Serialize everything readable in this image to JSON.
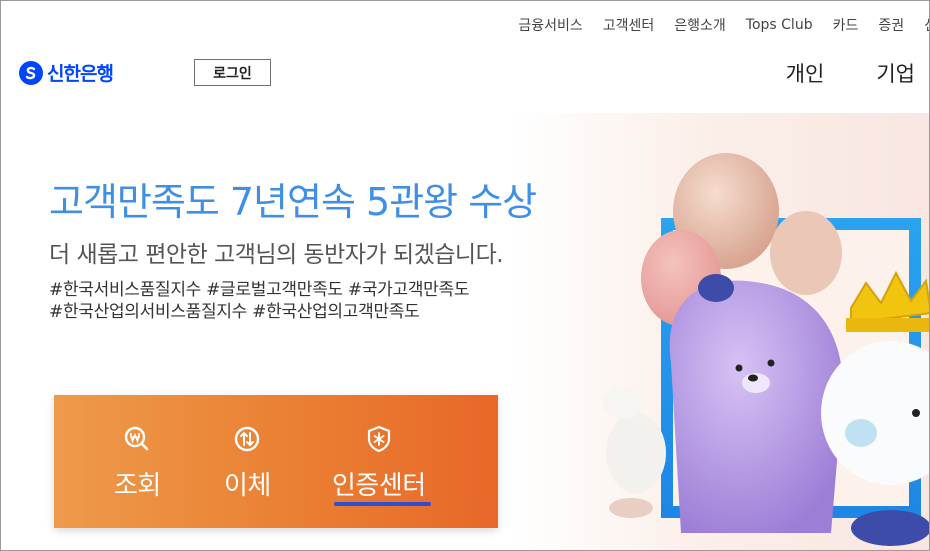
{
  "util_nav": [
    "금융서비스",
    "고객센터",
    "은행소개",
    "Tops Club",
    "카드",
    "증권",
    "신"
  ],
  "header": {
    "logo_text": "신한은행",
    "login_label": "로그인",
    "main_nav": [
      "개인",
      "기업"
    ]
  },
  "hero": {
    "title": "고객만족도 7년연속 5관왕 수상",
    "subtitle": "더 새롭고 편안한 고객님의 동반자가 되겠습니다.",
    "hashtags_line1": "#한국서비스품질지수  #글로벌고객만족도  #국가고객만족도",
    "hashtags_line2": "#한국산업의서비스품질지수  #한국산업의고객만족도"
  },
  "quick_menu": {
    "items": [
      {
        "label": "조회",
        "icon": "won-search-icon"
      },
      {
        "label": "이체",
        "icon": "transfer-arrows-icon"
      },
      {
        "label": "인증센터",
        "icon": "certificate-shield-icon"
      }
    ],
    "active_index": 2
  },
  "colors": {
    "brand_blue": "#0046ff",
    "title_blue": "#3f8fe6",
    "quick_orange": "#ea7f31",
    "active_underline": "#2e4ed6"
  }
}
